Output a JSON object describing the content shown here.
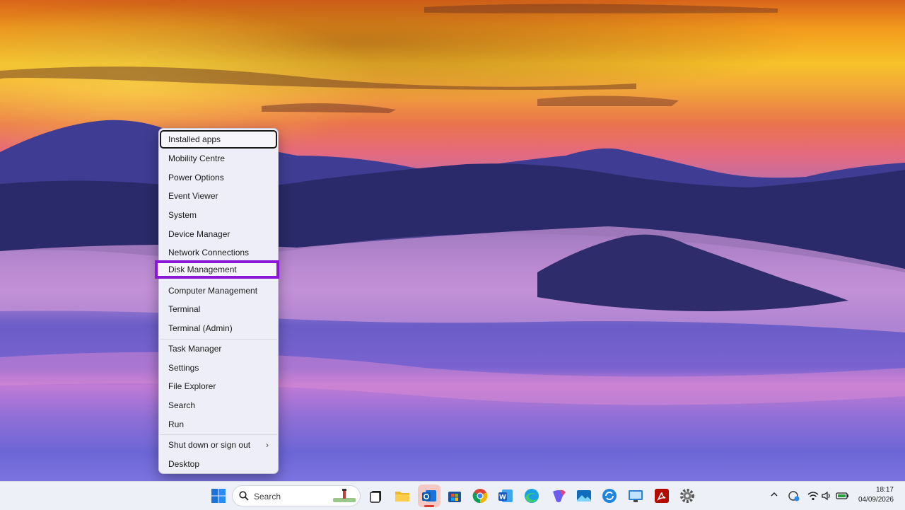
{
  "menu": {
    "items": [
      {
        "label": "Installed apps"
      },
      {
        "label": "Mobility Centre"
      },
      {
        "label": "Power Options"
      },
      {
        "label": "Event Viewer"
      },
      {
        "label": "System"
      },
      {
        "label": "Device Manager"
      },
      {
        "label": "Network Connections"
      },
      {
        "label": "Disk Management"
      },
      {
        "label": "Computer Management"
      },
      {
        "label": "Terminal"
      },
      {
        "label": "Terminal (Admin)"
      },
      {
        "label": "Task Manager"
      },
      {
        "label": "Settings"
      },
      {
        "label": "File Explorer"
      },
      {
        "label": "Search"
      },
      {
        "label": "Run"
      },
      {
        "label": "Shut down or sign out",
        "chevron": "›"
      },
      {
        "label": "Desktop"
      }
    ],
    "highlight_color": "#8a17d8"
  },
  "taskbar": {
    "search_label": "Search",
    "icons": [
      "windows-start-icon",
      "task-view-icon",
      "file-explorer-icon",
      "outlook-icon",
      "microsoft-store-icon",
      "chrome-icon",
      "word-icon",
      "edge-icon",
      "copilot-icon",
      "photos-icon",
      "sync-icon",
      "remote-desktop-icon",
      "acrobat-icon",
      "settings-gear-icon"
    ],
    "tray": {
      "time": "18:17",
      "date": "04/09/2026"
    }
  }
}
